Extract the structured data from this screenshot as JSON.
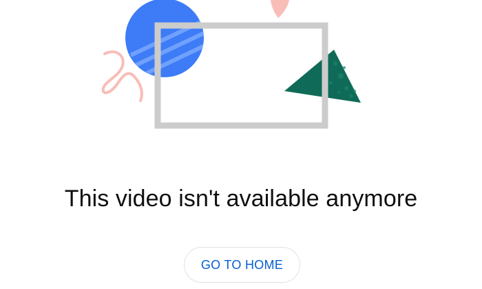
{
  "illustration": {
    "icons": [
      "blue-circle-shape",
      "pink-squiggle-shape",
      "pink-leaf-shape",
      "video-frame-outline",
      "green-triangle-shape"
    ]
  },
  "message": {
    "title": "This video isn't available anymore"
  },
  "actions": {
    "home_label": "GO TO HOME"
  },
  "colors": {
    "circle": "#3d7cf6",
    "circle_stripe": "#7aa8ff",
    "frame": "#cccccc",
    "triangle": "#0f6b57",
    "pink": "#f8bdb7",
    "text": "#0f0f0f",
    "link": "#065fd4"
  }
}
